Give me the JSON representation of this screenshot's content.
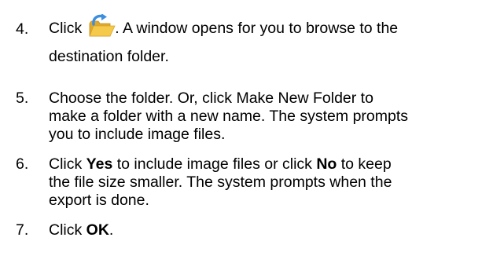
{
  "steps": [
    {
      "number": "4.",
      "before_icon": "Click",
      "icon": "open-folder-icon",
      "after_icon": ". A window opens for you to browse to the",
      "line2": "destination folder."
    },
    {
      "number": "5.",
      "lines": [
        "Choose the folder. Or, click Make New Folder to",
        "make a folder with a new name. The system prompts",
        "you to include image files."
      ]
    },
    {
      "number": "6.",
      "line1_pre": "Click ",
      "line1_bold_yes": "Yes",
      "line1_mid": " to include image files or click ",
      "line1_bold_no": "No",
      "line1_post": " to keep",
      "line2": "the file size smaller. The system prompts when the",
      "line3": "export is done."
    },
    {
      "number": "7.",
      "pre": "Click ",
      "bold": "OK",
      "post": "."
    }
  ],
  "colors": {
    "text": "#000000",
    "folder_yellow": "#f5c94a",
    "arrow_blue": "#3b8ee0"
  }
}
